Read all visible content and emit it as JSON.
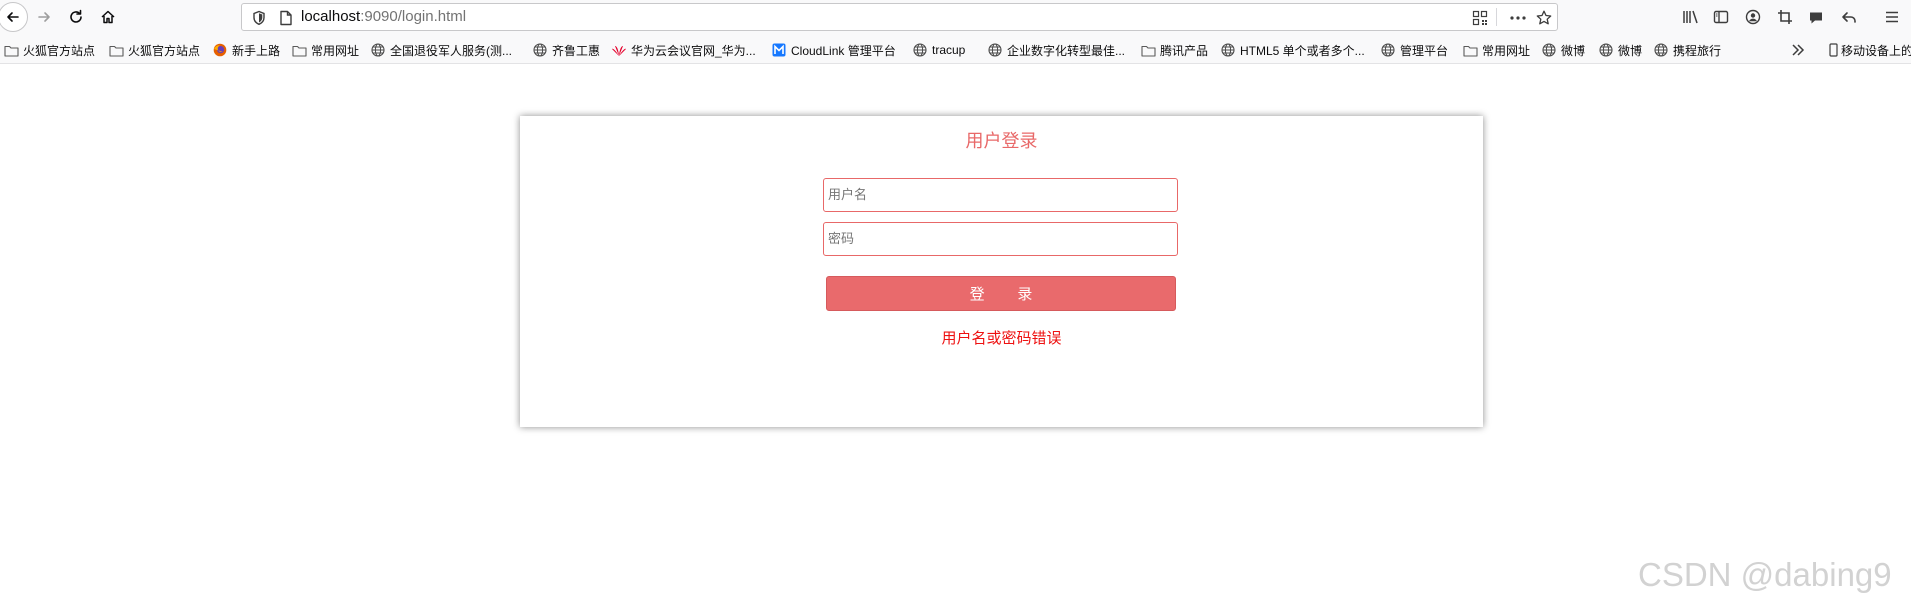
{
  "browser": {
    "url_host": "localhost",
    "url_rest": ":9090/login.html"
  },
  "bookmarks": [
    {
      "label": "火狐官方站点",
      "icon": "folder-icon"
    },
    {
      "label": "火狐官方站点",
      "icon": "folder-icon"
    },
    {
      "label": "新手上路",
      "icon": "firefox-icon"
    },
    {
      "label": "常用网址",
      "icon": "folder-icon"
    },
    {
      "label": "全国退役军人服务(测...",
      "icon": "globe-icon"
    },
    {
      "label": "齐鲁工惠",
      "icon": "globe-icon"
    },
    {
      "label": "华为云会议官网_华为...",
      "icon": "huawei-icon"
    },
    {
      "label": "CloudLink 管理平台",
      "icon": "cloudlink-icon"
    },
    {
      "label": "tracup",
      "icon": "globe-icon"
    },
    {
      "label": "企业数字化转型最佳...",
      "icon": "globe-icon"
    },
    {
      "label": "腾讯产品",
      "icon": "folder-icon"
    },
    {
      "label": "HTML5 单个或者多个...",
      "icon": "globe-icon"
    },
    {
      "label": "管理平台",
      "icon": "globe-icon"
    },
    {
      "label": "常用网址",
      "icon": "folder-icon"
    },
    {
      "label": "微博",
      "icon": "globe-icon"
    },
    {
      "label": "微博",
      "icon": "globe-icon"
    },
    {
      "label": "携程旅行",
      "icon": "globe-icon"
    }
  ],
  "mobile_bookmarks": "移动设备上的书签",
  "login": {
    "title": "用户登录",
    "username_placeholder": "用户名",
    "password_placeholder": "密码",
    "submit_label": "登 录",
    "error_message": "用户名或密码错误"
  },
  "watermark": "CSDN @dabing9",
  "colors": {
    "accent": "#e86868",
    "button": "#e96a6c",
    "error": "#ee1111"
  }
}
